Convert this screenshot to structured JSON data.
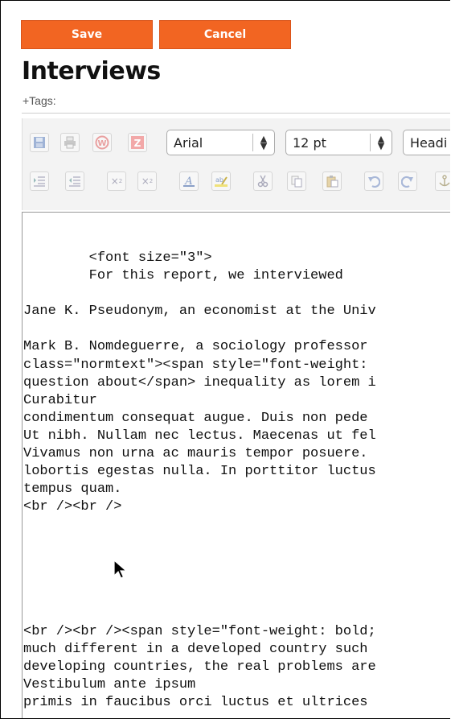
{
  "actions": {
    "save_label": "Save",
    "cancel_label": "Cancel"
  },
  "page": {
    "title": "Interviews",
    "tags_label": "+Tags:"
  },
  "toolbar": {
    "font_family": "Arial",
    "font_size": "12 pt",
    "block_format": "Headi",
    "row1_icons": [
      "save-icon",
      "print-icon",
      "word-paste-icon",
      "zoho-icon"
    ],
    "row2_icons": [
      "indent-icon",
      "outdent-icon",
      "subscript-icon",
      "superscript-icon",
      "font-color-icon",
      "highlight-icon",
      "cut-icon",
      "copy-icon",
      "paste-icon",
      "undo-icon",
      "redo-icon",
      "anchor-icon"
    ]
  },
  "editor": {
    "lines": [
      "        <font size=\"3\">",
      "        For this report, we interviewed",
      "",
      "Jane K. Pseudonym, an economist at the Univ",
      "",
      "Mark B. Nomdeguerre, a sociology professor",
      "class=\"normtext\"><span style=\"font-weight:",
      "question about</span> inequality as lorem i",
      "Curabitur",
      "condimentum consequat augue. Duis non pede",
      "Ut nibh. Nullam nec lectus. Maecenas ut fel",
      "Vivamus non urna ac mauris tempor posuere.",
      "lobortis egestas nulla. In porttitor luctus",
      "tempus quam.",
      "<br /><br />",
      "",
      "",
      "",
      "",
      "",
      "",
      "<br /><br /><span style=\"font-weight: bold;",
      "much different in a developed country such",
      "developing countries, the real problems are",
      "Vestibulum ante ipsum",
      "primis in faucibus orci luctus et ultrices"
    ]
  },
  "colors": {
    "button": "#f26522",
    "toolbar_bg": "#f3f3f3"
  }
}
